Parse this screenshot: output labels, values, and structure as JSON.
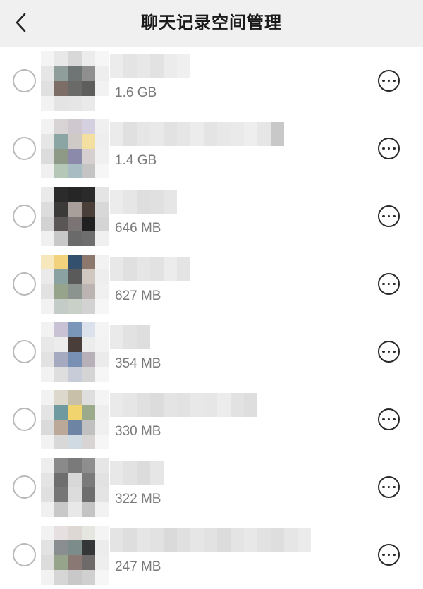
{
  "header": {
    "title": "聊天记录空间管理",
    "back_icon": "chevron-left-icon"
  },
  "chats": [
    {
      "size": "1.6 GB",
      "avatar": [
        "#f4f4f4",
        "#e8e8e8",
        "#d8d8d8",
        "#ececec",
        "#f6f6f6",
        "#e6e6e6",
        "#8f9e9a",
        "#6f7474",
        "#8e8f8e",
        "#eeeeee",
        "#e0e0e0",
        "#7c6e66",
        "#6a6a68",
        "#5e5e5c",
        "#f2f2f2",
        "#f2f2f2",
        "#e4e4e4",
        "#e6e6e6",
        "#eaeaea",
        "#ffffff"
      ],
      "name_blur": [
        "#ececec",
        "#e4e4e4",
        "#e8e8e8",
        "#e2e2e2",
        "#ececec",
        "#f0f0f0"
      ]
    },
    {
      "size": "1.4 GB",
      "avatar": [
        "#f2f2f2",
        "#d8d4d6",
        "#cfc8cf",
        "#d4d0e0",
        "#f0f0f0",
        "#e6e6e6",
        "#8aa5a4",
        "#cfcac6",
        "#f3dfa0",
        "#eeeeee",
        "#dcdcdc",
        "#8e9a86",
        "#8c8aaa",
        "#d6cfd0",
        "#f0f0f0",
        "#f0f0f0",
        "#b5c7b6",
        "#a8bcc4",
        "#c4c4c4",
        "#f6f6f6"
      ],
      "name_blur": [
        "#ebebeb",
        "#e0e0e0",
        "#e6e6e6",
        "#e9e9e9",
        "#e2e2e2",
        "#e6e6e6",
        "#ececec",
        "#e4e4e4",
        "#e8e8e8",
        "#eaeaea",
        "#eeeeee",
        "#e6e6e6",
        "#c8c8c8"
      ]
    },
    {
      "size": "646 MB",
      "avatar": [
        "#eaeaea",
        "#2b2b2b",
        "#262626",
        "#2a2a2a",
        "#e4e4e4",
        "#dcdcdc",
        "#3c3a38",
        "#a89e9a",
        "#4a3e38",
        "#d8d8d8",
        "#d2d2d2",
        "#5a5656",
        "#7a7474",
        "#202020",
        "#d4d4d4",
        "#f0f0f0",
        "#c8c8c8",
        "#6a6a6a",
        "#6e6e6e",
        "#f0f0f0"
      ],
      "name_blur": [
        "#ececec",
        "#e6e6e6",
        "#dedede",
        "#e0e0e0",
        "#e6e6e6"
      ]
    },
    {
      "size": "627 MB",
      "avatar": [
        "#f6e7bc",
        "#f2d27c",
        "#33506e",
        "#8c786c",
        "#f2f2f2",
        "#eaeaea",
        "#8aa2a2",
        "#5a5a5a",
        "#d0c8c0",
        "#eeeeee",
        "#e2e2e2",
        "#96a48c",
        "#8c9490",
        "#bcb4b2",
        "#f0f0f0",
        "#f2f2f2",
        "#c4ccc8",
        "#c8d0c8",
        "#d2d2d2",
        "#f6f6f6"
      ],
      "name_blur": [
        "#e8e8e8",
        "#e0e0e0",
        "#e6e6e6",
        "#e2e2e2",
        "#ececec",
        "#e4e4e4"
      ]
    },
    {
      "size": "354 MB",
      "avatar": [
        "#f2f2f2",
        "#c8c2d4",
        "#7a96b8",
        "#dce2ec",
        "#f4f4f4",
        "#e8e8e8",
        "#ececec",
        "#4a3e3a",
        "#ececec",
        "#f2f2f2",
        "#e2e2e2",
        "#a6aac0",
        "#7890b4",
        "#b8b0b8",
        "#ebebeb",
        "#f2f2f2",
        "#dedede",
        "#c8ccd8",
        "#d4d4d4",
        "#f6f6f6"
      ],
      "name_blur": [
        "#eaeaea",
        "#e2e2e2",
        "#dedede"
      ]
    },
    {
      "size": "330 MB",
      "avatar": [
        "#f2f2f2",
        "#dcd8cc",
        "#c8c0a8",
        "#dedede",
        "#f4f4f4",
        "#e4e4e4",
        "#6e9aa0",
        "#f2d46e",
        "#9aaa8a",
        "#eeeeee",
        "#dadada",
        "#bca898",
        "#6e84a4",
        "#c0c0c0",
        "#f0f0f0",
        "#f2f2f2",
        "#d8d8d8",
        "#cfdae2",
        "#d8d4d4",
        "#f6f6f6"
      ],
      "name_blur": [
        "#eaeaea",
        "#e6e6e6",
        "#e0e0e0",
        "#dcdcdc",
        "#e4e4e4",
        "#e2e2e2",
        "#e8e8e8",
        "#e6e6e6",
        "#ececec",
        "#e2e2e2",
        "#dedede"
      ]
    },
    {
      "size": "322 MB",
      "avatar": [
        "#eeeeee",
        "#8a8a8a",
        "#7a7a7a",
        "#8e8e8e",
        "#e6e6e6",
        "#e4e4e4",
        "#6e6e6e",
        "#d8d8d8",
        "#7a7a7a",
        "#e2e2e2",
        "#e0e0e0",
        "#767676",
        "#dcdcdc",
        "#6e6e6e",
        "#e4e4e4",
        "#f0f0f0",
        "#c8c8c8",
        "#e8e8e8",
        "#c4c4c4",
        "#f2f2f2"
      ],
      "name_blur": [
        "#e8e8e8",
        "#e2e2e2",
        "#dcdcdc",
        "#e6e6e6"
      ]
    },
    {
      "size": "247 MB",
      "avatar": [
        "#f2f2f2",
        "#e6e0e0",
        "#ddd8d4",
        "#e6e6e0",
        "#f4f4f4",
        "#e2e2e2",
        "#8a8e90",
        "#7c8c8a",
        "#343638",
        "#ececec",
        "#dcdcdc",
        "#96a48c",
        "#8a7874",
        "#6e6a6a",
        "#eeeeee",
        "#f2f2f2",
        "#d6d6d6",
        "#c8c8c8",
        "#d0d0d0",
        "#f6f6f6"
      ],
      "name_blur": [
        "#e4e4e4",
        "#dedede",
        "#e6e6e6",
        "#e2e2e2",
        "#dadada",
        "#e0e0e0",
        "#e6e6e6",
        "#e2e2e2",
        "#dcdcdc",
        "#e4e4e4",
        "#e8e8e8",
        "#e2e2e2",
        "#dedede",
        "#e6e6e6",
        "#ebebeb"
      ]
    }
  ]
}
